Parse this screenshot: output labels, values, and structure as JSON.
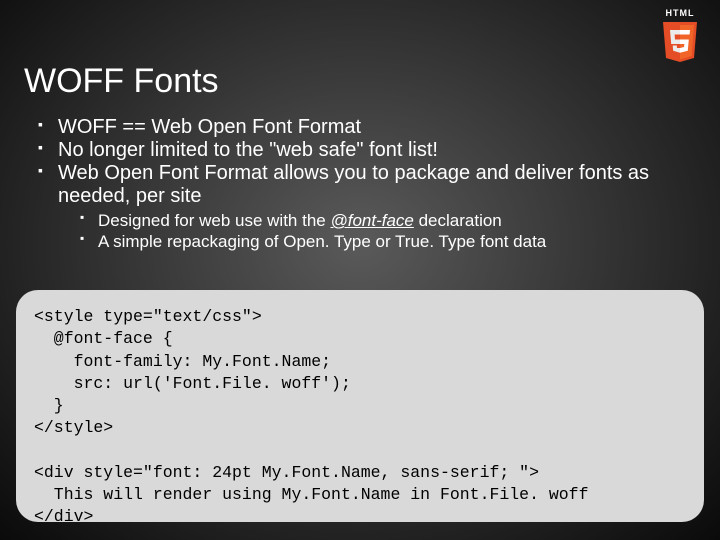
{
  "logo": {
    "label": "HTML",
    "five": "5"
  },
  "title": "WOFF Fonts",
  "bullets": [
    "WOFF == Web Open Font Format",
    "No longer limited to the \"web safe\" font list!",
    "Web Open Font Format allows you to package and deliver fonts as needed, per site"
  ],
  "subbullets": {
    "prefix": "Designed for web use with the ",
    "ital": "@font-face",
    "suffix": " declaration",
    "second": "A simple repackaging of Open. Type or True. Type font data"
  },
  "code": "<style type=\"text/css\">\n  @font-face {\n    font-family: My.Font.Name;\n    src: url('Font.File. woff');\n  }\n</style>\n\n<div style=\"font: 24pt My.Font.Name, sans-serif; \">\n  This will render using My.Font.Name in Font.File. woff\n</div>"
}
